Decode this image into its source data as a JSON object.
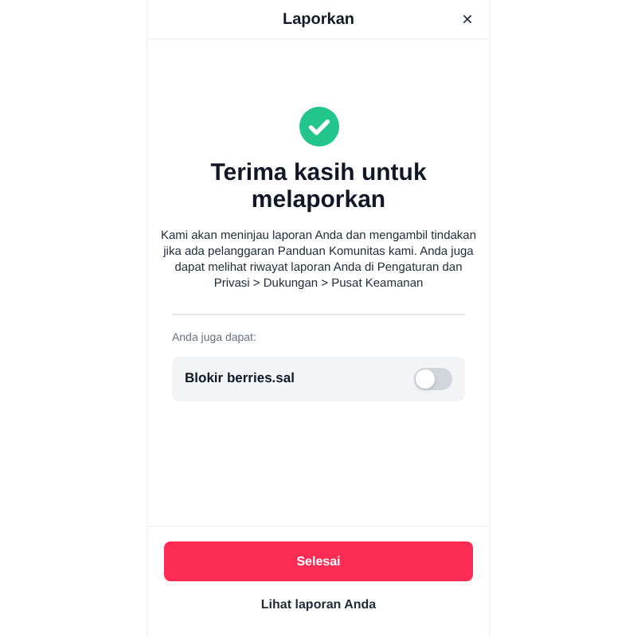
{
  "header": {
    "title": "Laporkan",
    "close": "×"
  },
  "confirmation": {
    "title": "Terima kasih untuk melaporkan",
    "body": "Kami akan meninjau laporan Anda dan mengambil tindakan jika ada pelanggaran Panduan Komunitas kami. Anda juga dapat melihat riwayat laporan Anda di Pengaturan dan Privasi > Dukungan > Pusat Keamanan"
  },
  "options": {
    "label": "Anda juga dapat:",
    "items": [
      {
        "label": "Blokir berries.sal",
        "on": false
      }
    ]
  },
  "buttons": {
    "primary": "Selesai",
    "secondary": "Lihat laporan Anda"
  }
}
